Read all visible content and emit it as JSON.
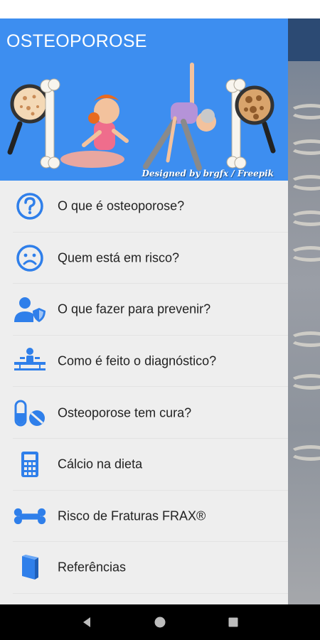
{
  "app": {
    "title": "OSTEOPOROSE",
    "credit": "Designed by brgfx / Freepik"
  },
  "theme": {
    "header_bg": "#3d8ef0",
    "icon_color": "#2f7fea",
    "drawer_bg": "#eeeeee",
    "nav_bg": "#000000"
  },
  "menu": {
    "items": [
      {
        "label": "O que é osteoporose?",
        "icon": "question-circle-icon"
      },
      {
        "label": "Quem está em risco?",
        "icon": "sad-face-icon"
      },
      {
        "label": "O que fazer para prevenir?",
        "icon": "user-shield-icon"
      },
      {
        "label": "Como é feito o diagnóstico?",
        "icon": "x-ray-table-icon"
      },
      {
        "label": "Osteoporose tem cura?",
        "icon": "pills-icon"
      },
      {
        "label": "Cálcio na dieta",
        "icon": "calculator-icon"
      },
      {
        "label": "Risco de Fraturas FRAX®",
        "icon": "bone-icon"
      },
      {
        "label": "Referências",
        "icon": "book-icon"
      }
    ]
  },
  "nav": {
    "buttons": [
      "back",
      "home",
      "recents"
    ]
  }
}
